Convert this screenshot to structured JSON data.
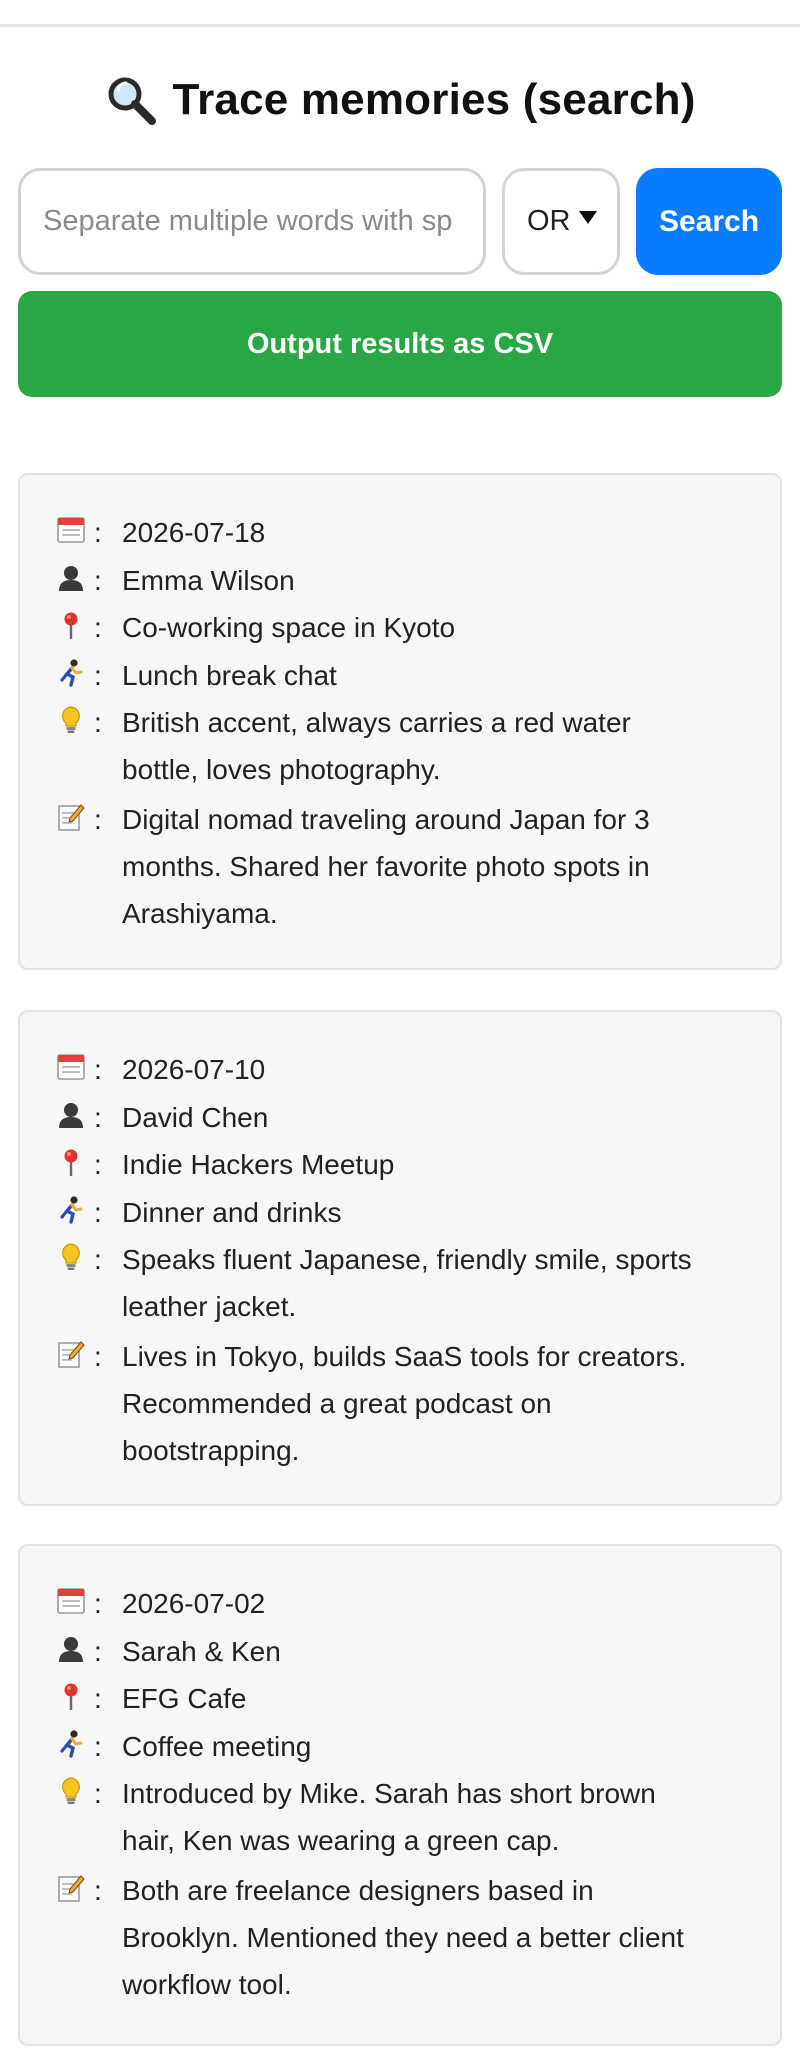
{
  "header": {
    "title": "Trace memories (search)",
    "icon": "magnifier-icon"
  },
  "search": {
    "placeholder": "Separate multiple words with sp",
    "value": "",
    "operator": "OR",
    "button_label": "Search"
  },
  "export": {
    "label": "Output results as CSV"
  },
  "colors": {
    "search_button": "#0b7cff",
    "csv_button": "#2aa745",
    "card_background": "#f7f7f7"
  },
  "field_icons": {
    "date": "calendar-icon",
    "person": "person-icon",
    "location": "pushpin-icon",
    "situation": "running-person-icon",
    "features": "lightbulb-icon",
    "notes": "memo-icon"
  },
  "results": [
    {
      "date": "2026-07-18",
      "person": "Emma Wilson",
      "location": "Co-working space in Kyoto",
      "situation": "Lunch break chat",
      "features_lines": [
        "British accent, always carries a red water",
        "bottle, loves photography."
      ],
      "notes_lines": [
        "Digital nomad traveling around Japan for 3",
        "months. Shared her favorite photo spots in",
        "Arashiyama."
      ]
    },
    {
      "date": "2026-07-10",
      "person": "David Chen",
      "location": "Indie Hackers Meetup",
      "situation": "Dinner and drinks",
      "features_lines": [
        "Speaks fluent Japanese, friendly smile, sports",
        "leather jacket."
      ],
      "notes_lines": [
        "Lives in Tokyo, builds SaaS tools for creators.",
        "Recommended a great podcast on",
        "bootstrapping."
      ]
    },
    {
      "date": "2026-07-02",
      "person": "Sarah & Ken",
      "location": "EFG Cafe",
      "situation": "Coffee meeting",
      "features_lines": [
        "Introduced by Mike. Sarah has short brown",
        "hair, Ken was wearing a green cap."
      ],
      "notes_lines": [
        "Both are freelance designers based in",
        "Brooklyn. Mentioned they need a better client",
        "workflow tool."
      ]
    }
  ]
}
